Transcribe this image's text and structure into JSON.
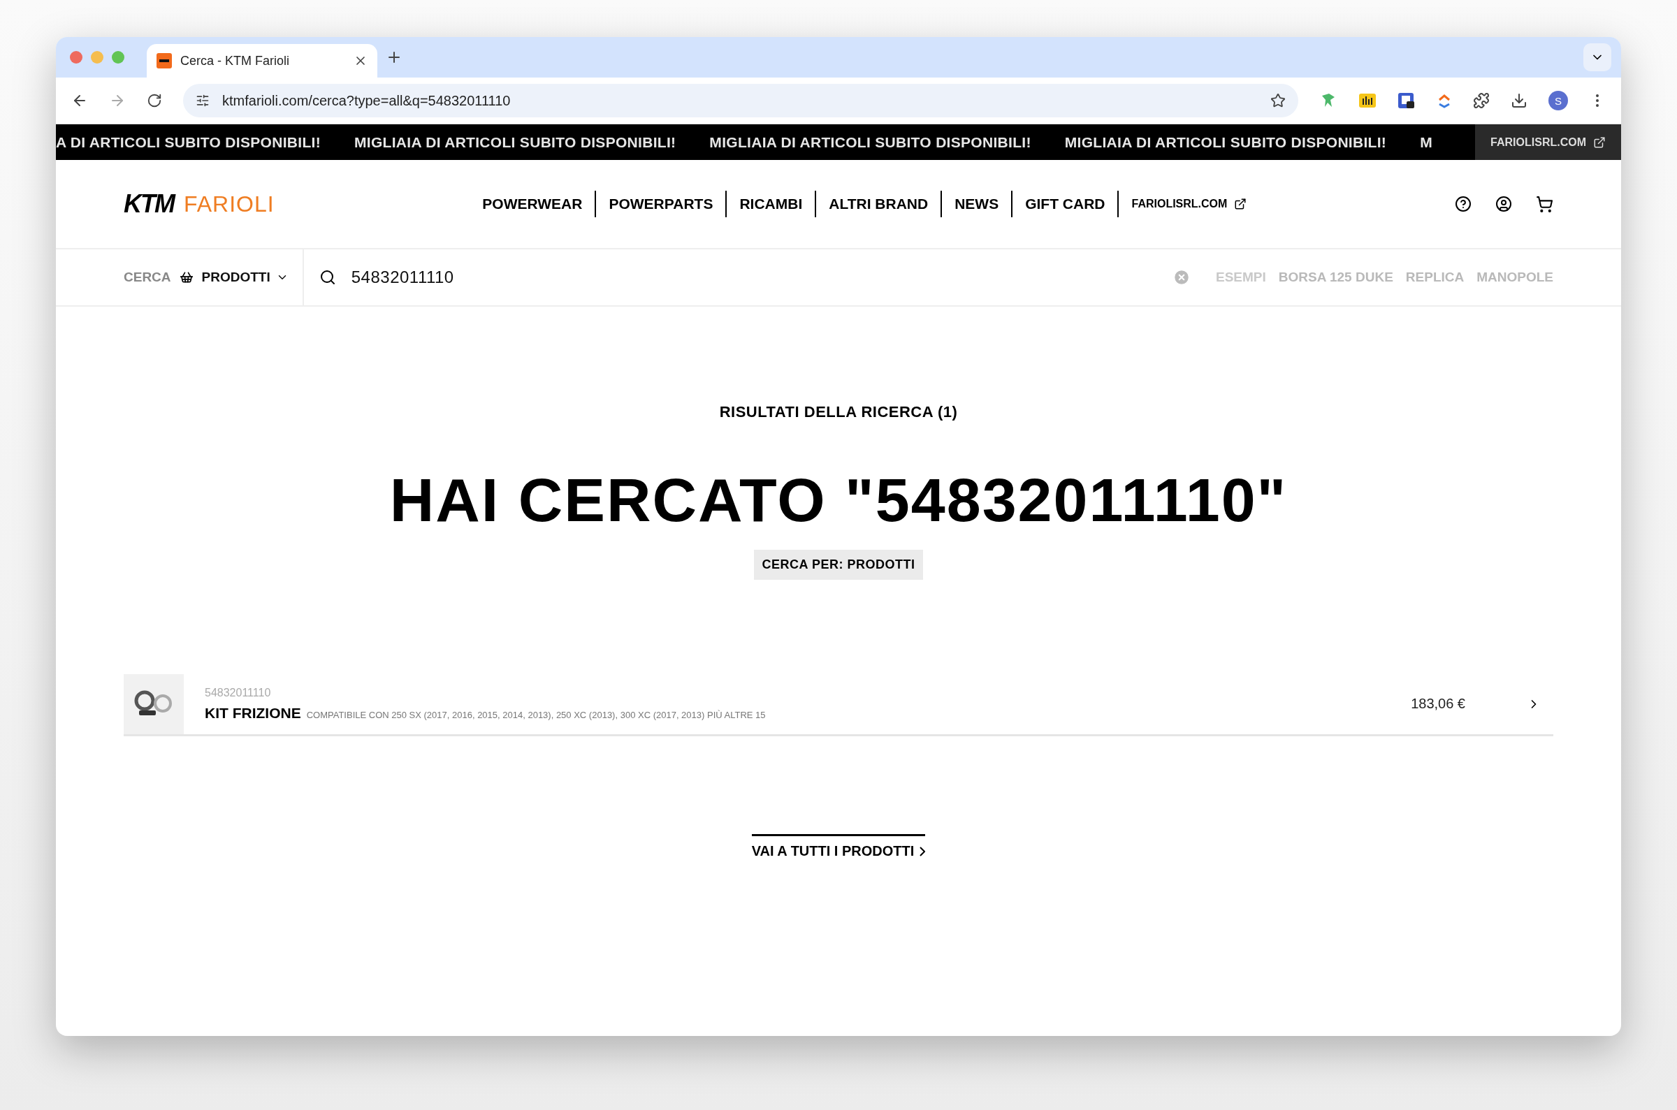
{
  "browser": {
    "tab": {
      "title": "Cerca - KTM Farioli",
      "selected": true
    },
    "url": "ktmfarioli.com/cerca?type=all&q=54832011110",
    "profile_initial": "S"
  },
  "marquee": {
    "items": [
      "A DI ARTICOLI SUBITO DISPONIBILI!",
      "MIGLIAIA DI ARTICOLI SUBITO DISPONIBILI!",
      "MIGLIAIA DI ARTICOLI SUBITO DISPONIBILI!",
      "MIGLIAIA DI ARTICOLI SUBITO DISPONIBILI!",
      "M"
    ],
    "link": "FARIOLISRL.COM"
  },
  "header": {
    "logo_mark": "KTM",
    "logo_name": "FARIOLI",
    "nav": [
      "POWERWEAR",
      "POWERPARTS",
      "RICAMBI",
      "ALTRI BRAND",
      "NEWS",
      "GIFT CARD"
    ],
    "external_link": "FARIOLISRL.COM"
  },
  "search": {
    "label": "CERCA",
    "scope": "PRODOTTI",
    "value": "54832011110",
    "examples_label": "ESEMPI",
    "examples": [
      "BORSA 125 DUKE",
      "REPLICA",
      "MANOPOLE"
    ]
  },
  "results": {
    "heading": "RISULTATI DELLA RICERCA (1)",
    "title": "HAI CERCATO \"54832011110\"",
    "filter": "CERCA PER: PRODOTTI",
    "products": [
      {
        "code": "54832011110",
        "name": "KIT FRIZIONE",
        "compatibility": "COMPATIBILE CON 250 SX (2017, 2016, 2015, 2014, 2013), 250 XC (2013), 300 XC (2017, 2013) PIÙ ALTRE 15",
        "price": "183,06 €"
      }
    ],
    "all_link": "VAI A TUTTI I PRODOTTI"
  }
}
